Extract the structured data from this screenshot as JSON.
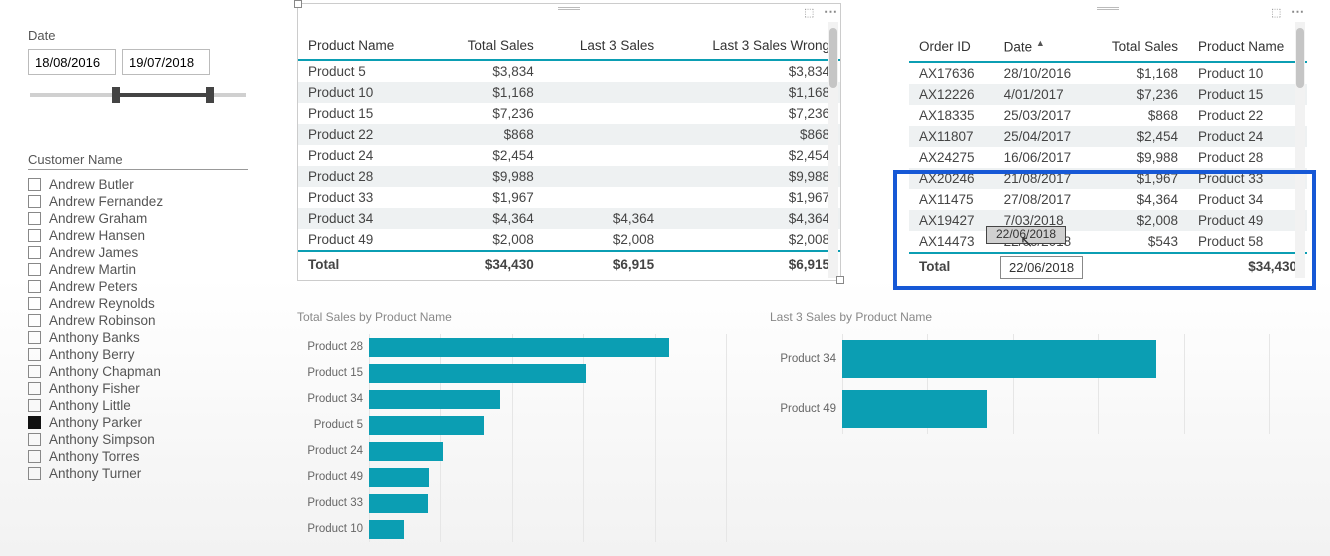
{
  "date_slicer": {
    "title": "Date",
    "from": "18/08/2016",
    "to": "19/07/2018"
  },
  "customer_slicer": {
    "title": "Customer Name",
    "items": [
      {
        "name": "Andrew Butler",
        "checked": false
      },
      {
        "name": "Andrew Fernandez",
        "checked": false
      },
      {
        "name": "Andrew Graham",
        "checked": false
      },
      {
        "name": "Andrew Hansen",
        "checked": false
      },
      {
        "name": "Andrew James",
        "checked": false
      },
      {
        "name": "Andrew Martin",
        "checked": false
      },
      {
        "name": "Andrew Peters",
        "checked": false
      },
      {
        "name": "Andrew Reynolds",
        "checked": false
      },
      {
        "name": "Andrew Robinson",
        "checked": false
      },
      {
        "name": "Anthony Banks",
        "checked": false
      },
      {
        "name": "Anthony Berry",
        "checked": false
      },
      {
        "name": "Anthony Chapman",
        "checked": false
      },
      {
        "name": "Anthony Fisher",
        "checked": false
      },
      {
        "name": "Anthony Little",
        "checked": false
      },
      {
        "name": "Anthony Parker",
        "checked": true
      },
      {
        "name": "Anthony Simpson",
        "checked": false
      },
      {
        "name": "Anthony Torres",
        "checked": false
      },
      {
        "name": "Anthony Turner",
        "checked": false
      }
    ]
  },
  "table1": {
    "headers": [
      "Product Name",
      "Total Sales",
      "Last 3 Sales",
      "Last 3 Sales Wrong"
    ],
    "rows": [
      {
        "product": "Product 5",
        "total": "$3,834",
        "last3": "",
        "last3w": "$3,834"
      },
      {
        "product": "Product 10",
        "total": "$1,168",
        "last3": "",
        "last3w": "$1,168"
      },
      {
        "product": "Product 15",
        "total": "$7,236",
        "last3": "",
        "last3w": "$7,236"
      },
      {
        "product": "Product 22",
        "total": "$868",
        "last3": "",
        "last3w": "$868"
      },
      {
        "product": "Product 24",
        "total": "$2,454",
        "last3": "",
        "last3w": "$2,454"
      },
      {
        "product": "Product 28",
        "total": "$9,988",
        "last3": "",
        "last3w": "$9,988"
      },
      {
        "product": "Product 33",
        "total": "$1,967",
        "last3": "",
        "last3w": "$1,967"
      },
      {
        "product": "Product 34",
        "total": "$4,364",
        "last3": "$4,364",
        "last3w": "$4,364"
      },
      {
        "product": "Product 49",
        "total": "$2,008",
        "last3": "$2,008",
        "last3w": "$2,008"
      }
    ],
    "total_label": "Total",
    "totals": [
      "$34,430",
      "$6,915",
      "$6,915"
    ]
  },
  "table2": {
    "headers": [
      "Order ID",
      "Date",
      "Total Sales",
      "Product Name"
    ],
    "rows": [
      {
        "order": "AX17636",
        "date": "28/10/2016",
        "total": "$1,168",
        "product": "Product 10"
      },
      {
        "order": "AX12226",
        "date": "4/01/2017",
        "total": "$7,236",
        "product": "Product 15"
      },
      {
        "order": "AX18335",
        "date": "25/03/2017",
        "total": "$868",
        "product": "Product 22"
      },
      {
        "order": "AX11807",
        "date": "25/04/2017",
        "total": "$2,454",
        "product": "Product 24"
      },
      {
        "order": "AX24275",
        "date": "16/06/2017",
        "total": "$9,988",
        "product": "Product 28"
      },
      {
        "order": "AX20246",
        "date": "21/08/2017",
        "total": "$1,967",
        "product": "Product 33"
      },
      {
        "order": "AX11475",
        "date": "27/08/2017",
        "total": "$4,364",
        "product": "Product 34"
      },
      {
        "order": "AX19427",
        "date": "7/03/2018",
        "total": "$2,008",
        "product": "Product 49"
      },
      {
        "order": "AX14473",
        "date": "22/06/2018",
        "total": "$543",
        "product": "Product 58"
      }
    ],
    "total_label": "Total",
    "totals": [
      "$34,430"
    ],
    "selected_cell": "22/06/2018",
    "tooltip": "22/06/2018"
  },
  "chart1_title": "Total Sales by Product Name",
  "chart2_title": "Last 3 Sales by Product Name",
  "chart_data": [
    {
      "type": "bar",
      "orientation": "horizontal",
      "title": "Total Sales by Product Name",
      "xlabel": "",
      "ylabel": "",
      "categories": [
        "Product 28",
        "Product 15",
        "Product 34",
        "Product 5",
        "Product 24",
        "Product 49",
        "Product 33",
        "Product 10"
      ],
      "values": [
        9988,
        7236,
        4364,
        3834,
        2454,
        2008,
        1967,
        1168
      ],
      "xlim": [
        0,
        10000
      ]
    },
    {
      "type": "bar",
      "orientation": "horizontal",
      "title": "Last 3 Sales by Product Name",
      "xlabel": "",
      "ylabel": "",
      "categories": [
        "Product 34",
        "Product 49"
      ],
      "values": [
        4364,
        2008
      ],
      "xlim": [
        0,
        5000
      ]
    }
  ],
  "colors": {
    "accent": "#0b9eb3",
    "highlight": "#1658d6"
  }
}
